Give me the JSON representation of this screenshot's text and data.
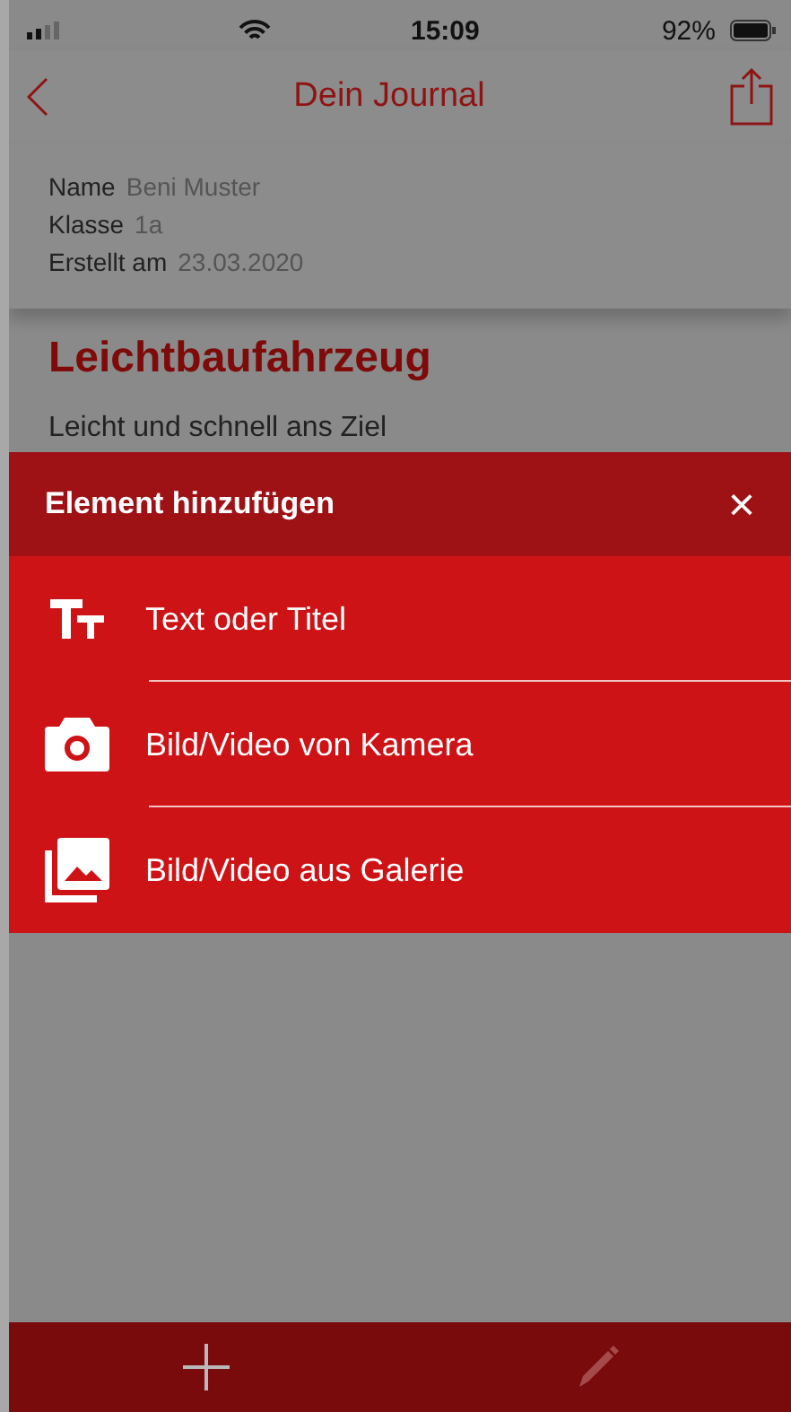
{
  "status_bar": {
    "time": "15:09",
    "battery": "92%"
  },
  "nav": {
    "title": "Dein Journal"
  },
  "info": [
    {
      "label": "Name",
      "value": "Beni Muster"
    },
    {
      "label": "Klasse",
      "value": "1a"
    },
    {
      "label": "Erstellt am",
      "value": "23.03.2020"
    }
  ],
  "journal": {
    "title": "Leichtbaufahrzeug",
    "subtitle": "Leicht und schnell ans Ziel"
  },
  "sheet": {
    "title": "Element hinzufügen",
    "close": "×",
    "items": [
      {
        "kind": "text",
        "label": "Text oder Titel"
      },
      {
        "kind": "camera",
        "label": "Bild/Video von Kamera"
      },
      {
        "kind": "gallery",
        "label": "Bild/Video aus Galerie"
      }
    ]
  }
}
